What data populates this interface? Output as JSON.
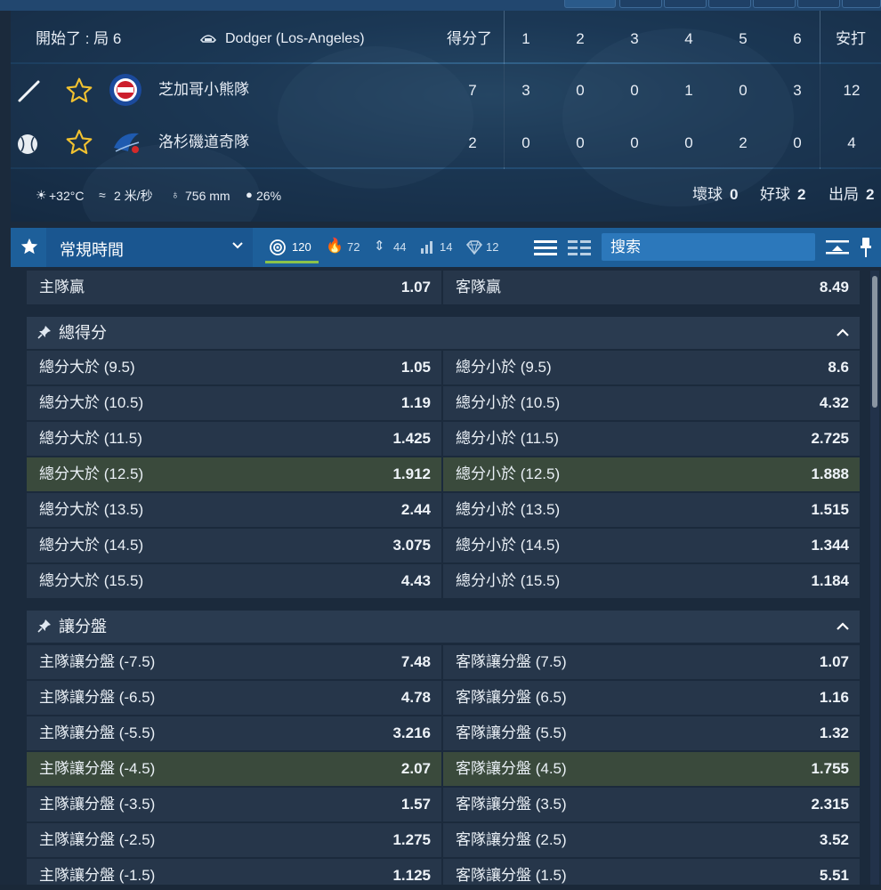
{
  "scoreboard": {
    "status": "開始了 : 局 6",
    "stadium": "Dodger (Los-Angeles)",
    "runs_header": "得分了",
    "innings": [
      "1",
      "2",
      "3",
      "4",
      "5",
      "6"
    ],
    "hits_header": "安打",
    "teams": [
      {
        "name": "芝加哥小熊隊",
        "runs": "7",
        "innings": [
          "3",
          "0",
          "0",
          "1",
          "0",
          "3"
        ],
        "hits": "12",
        "logo": "cubs-logo",
        "role_icon": "bat-icon"
      },
      {
        "name": "洛杉磯道奇隊",
        "runs": "2",
        "innings": [
          "0",
          "0",
          "0",
          "0",
          "2",
          "0"
        ],
        "hits": "4",
        "logo": "dodgers-logo",
        "role_icon": "baseball-icon"
      }
    ],
    "weather": {
      "temp": "+32°C",
      "wind": "2 米/秒",
      "pressure": "756 mm",
      "humidity": "26%"
    },
    "counts": {
      "balls_label": "壞球",
      "balls": "0",
      "strikes_label": "好球",
      "strikes": "2",
      "outs_label": "出局",
      "outs": "2"
    }
  },
  "toolbar": {
    "period": "常規時間",
    "filters": [
      {
        "icon": "target-icon",
        "count": "120"
      },
      {
        "icon": "fire-icon",
        "count": "72"
      },
      {
        "icon": "updown-icon",
        "count": "44"
      },
      {
        "icon": "stats-icon",
        "count": "14"
      },
      {
        "icon": "diamond-icon",
        "count": "12"
      }
    ],
    "search_placeholder": "搜索"
  },
  "markets": {
    "winner": {
      "home_label": "主隊贏",
      "home_odd": "1.07",
      "away_label": "客隊贏",
      "away_odd": "8.49"
    },
    "total": {
      "title": "總得分",
      "rows": [
        {
          "l": "總分大於 (9.5)",
          "lo": "1.05",
          "r": "總分小於 (9.5)",
          "ro": "8.6"
        },
        {
          "l": "總分大於 (10.5)",
          "lo": "1.19",
          "r": "總分小於 (10.5)",
          "ro": "4.32"
        },
        {
          "l": "總分大於 (11.5)",
          "lo": "1.425",
          "r": "總分小於 (11.5)",
          "ro": "2.725"
        },
        {
          "l": "總分大於 (12.5)",
          "lo": "1.912",
          "r": "總分小於 (12.5)",
          "ro": "1.888"
        },
        {
          "l": "總分大於 (13.5)",
          "lo": "2.44",
          "r": "總分小於 (13.5)",
          "ro": "1.515"
        },
        {
          "l": "總分大於 (14.5)",
          "lo": "3.075",
          "r": "總分小於 (14.5)",
          "ro": "1.344"
        },
        {
          "l": "總分大於 (15.5)",
          "lo": "4.43",
          "r": "總分小於 (15.5)",
          "ro": "1.184"
        }
      ]
    },
    "handicap": {
      "title": "讓分盤",
      "rows": [
        {
          "l": "主隊讓分盤 (-7.5)",
          "lo": "7.48",
          "r": "客隊讓分盤 (7.5)",
          "ro": "1.07"
        },
        {
          "l": "主隊讓分盤 (-6.5)",
          "lo": "4.78",
          "r": "客隊讓分盤 (6.5)",
          "ro": "1.16"
        },
        {
          "l": "主隊讓分盤 (-5.5)",
          "lo": "3.216",
          "r": "客隊讓分盤 (5.5)",
          "ro": "1.32"
        },
        {
          "l": "主隊讓分盤 (-4.5)",
          "lo": "2.07",
          "r": "客隊讓分盤 (4.5)",
          "ro": "1.755"
        },
        {
          "l": "主隊讓分盤 (-3.5)",
          "lo": "1.57",
          "r": "客隊讓分盤 (3.5)",
          "ro": "2.315"
        },
        {
          "l": "主隊讓分盤 (-2.5)",
          "lo": "1.275",
          "r": "客隊讓分盤 (2.5)",
          "ro": "3.52"
        },
        {
          "l": "主隊讓分盤 (-1.5)",
          "lo": "1.125",
          "r": "客隊讓分盤 (1.5)",
          "ro": "5.51"
        }
      ]
    }
  },
  "colors": {
    "accent": "#1d5f9a",
    "highlight_row": "#3a4a3c",
    "star": "#f2c230",
    "active_underline": "#8bc34a"
  }
}
